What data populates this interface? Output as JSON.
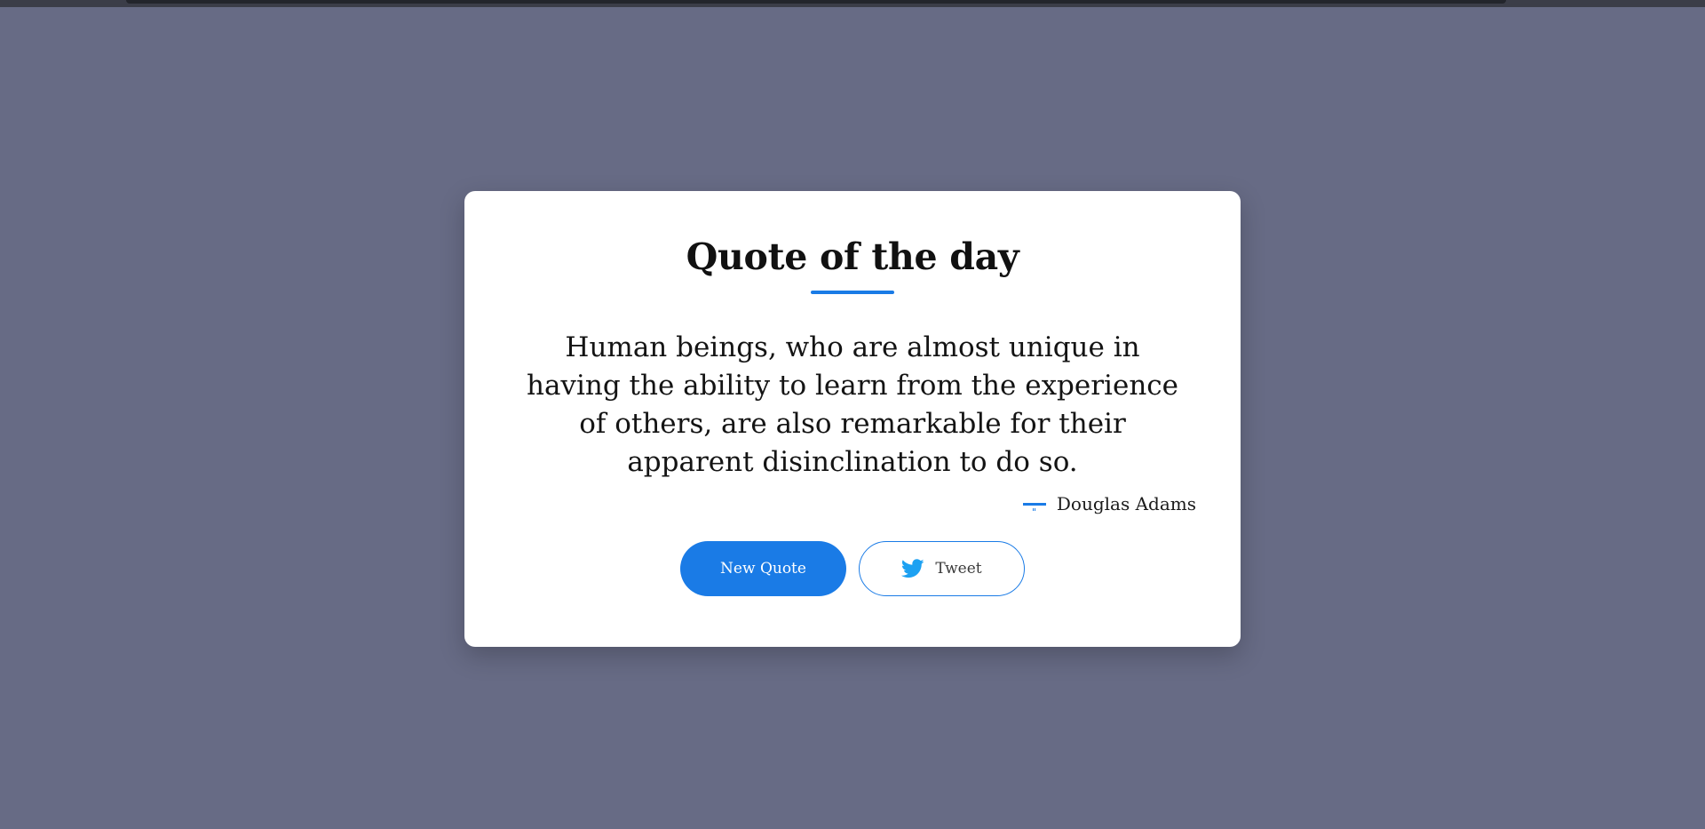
{
  "card": {
    "title": "Quote of the day",
    "quote_text": "Human beings, who are almost unique in having the ability to learn from the experience of others, are also remarkable for their apparent disinclination to do so.",
    "author": "Douglas Adams"
  },
  "buttons": {
    "new_quote_label": "New Quote",
    "tweet_label": "Tweet"
  },
  "icons": {
    "tweet": "twitter-bird-icon",
    "author_marker": "dash-icon"
  },
  "colors": {
    "background": "#676b85",
    "accent": "#1a7be6",
    "twitter": "#1da1f2",
    "card": "#ffffff"
  }
}
